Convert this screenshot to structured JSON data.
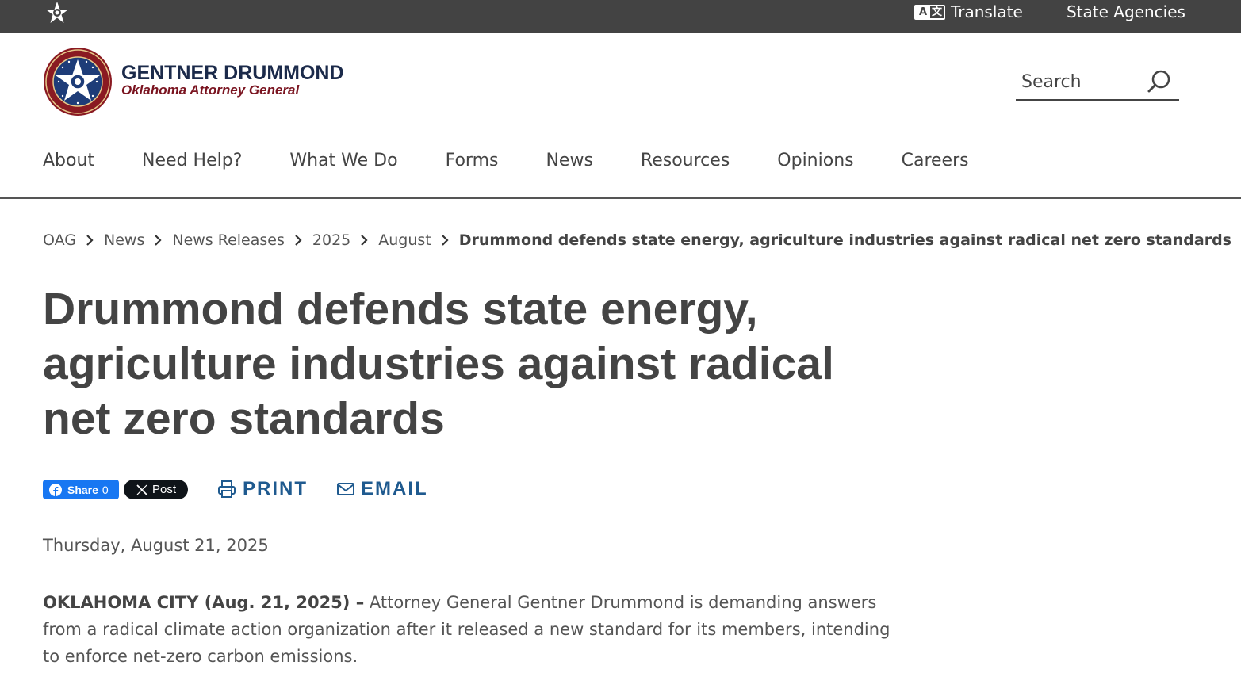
{
  "topbar": {
    "translate_label": "Translate",
    "translate_icon_letters": [
      "A",
      "文"
    ],
    "agencies_label": "State Agencies",
    "background": "#434343"
  },
  "header": {
    "brand_name": "GENTNER DRUMMOND",
    "brand_subtitle": "Oklahoma Attorney General",
    "seal_text": [
      "OFFICE OF THE ATTORNEY GENERAL",
      "OKLAHOMA"
    ],
    "search_placeholder": "Search"
  },
  "nav": {
    "items": [
      "About",
      "Need Help?",
      "What We Do",
      "Forms",
      "News",
      "Resources",
      "Opinions",
      "Careers"
    ]
  },
  "breadcrumb": {
    "items": [
      "OAG",
      "News",
      "News Releases",
      "2025",
      "August"
    ],
    "current": "Drummond defends state energy, agriculture industries against radical net zero standards"
  },
  "article": {
    "headline": "Drummond defends state energy, agriculture industries against radical net zero standards",
    "date": "Thursday, August 21, 2025",
    "dateline": "OKLAHOMA CITY (Aug. 21, 2025) –",
    "lead": "Attorney General Gentner Drummond is demanding answers from a radical climate action organization after it released a new standard for its members, intending to enforce net-zero carbon emissions."
  },
  "share": {
    "facebook_label": "Share",
    "facebook_count": "0",
    "x_label": "Post",
    "print_label": "PRINT",
    "email_label": "EMAIL"
  },
  "colors": {
    "link_blue": "#1f5a8f",
    "brand_navy": "#1b2a4a",
    "brand_red": "#7a1420",
    "facebook_blue": "#1877f2"
  }
}
